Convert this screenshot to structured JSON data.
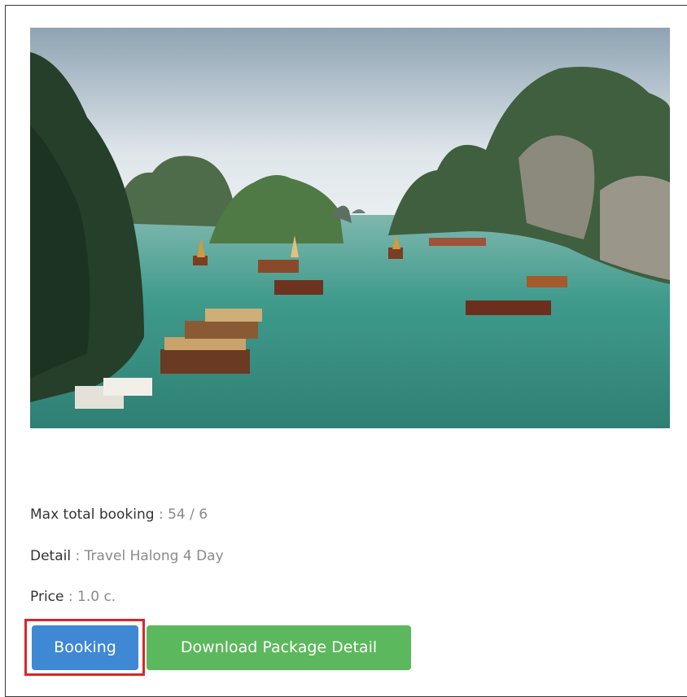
{
  "package": {
    "photo_icon": "landscape-photo",
    "max_booking_label": "Max total booking",
    "max_booking_value": " : 54 / 6",
    "detail_label": "Detail",
    "detail_value": " : Travel Halong 4 Day",
    "price_label": "Price",
    "price_value": " : 1.0 c."
  },
  "actions": {
    "booking_label": "Booking",
    "download_label": "Download Package Detail"
  },
  "colors": {
    "booking_button": "#3f88d4",
    "download_button": "#5cb85c",
    "highlight_border": "#d9262b"
  }
}
